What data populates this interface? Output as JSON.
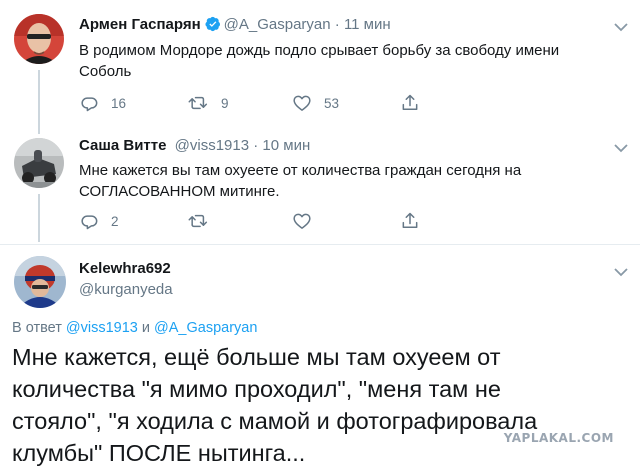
{
  "tweets": [
    {
      "name": "Армен Гаспарян",
      "handle": "@A_Gasparyan",
      "separator": "·",
      "time": "11 мин",
      "verified": true,
      "text": "В родимом Мордоре дождь подло срывает борьбу за свободу имени Соболь",
      "counts": {
        "replies": "16",
        "retweets": "9",
        "likes": "53"
      }
    },
    {
      "name": "Саша Витте",
      "handle": "@viss1913",
      "separator": "·",
      "time": "10 мин",
      "verified": false,
      "text": "Мне кажется вы там охуеете от количества граждан сегодня на СОГЛАСОВАННОМ митинге.",
      "counts": {
        "replies": "2",
        "retweets": "",
        "likes": ""
      }
    }
  ],
  "main_tweet": {
    "name": "Kelewhra692",
    "handle": "@kurganyeda",
    "reply_prefix": "В ответ",
    "reply_mention_1": "@viss1913",
    "reply_and": "и",
    "reply_mention_2": "@A_Gasparyan",
    "text": "Мне кажется, ещё больше мы там охуеем от количества \"я мимо проходил\", \"меня там не стояло\", \"я ходила с мамой и фотографировала клумбы\" ПОСЛЕ нытинга..."
  },
  "watermark": "YAPLAKAL.COM",
  "icons": {
    "reply": "reply-icon",
    "retweet": "retweet-icon",
    "like": "heart-icon",
    "share": "share-icon",
    "verified": "verified-badge-icon",
    "caret": "chevron-down-icon"
  },
  "colors": {
    "text": "#14171a",
    "secondary": "#657786",
    "link": "#1da1f2",
    "verified": "#1da1f2",
    "divider": "#e6ecf0",
    "thread_line": "#ccd6dd"
  }
}
